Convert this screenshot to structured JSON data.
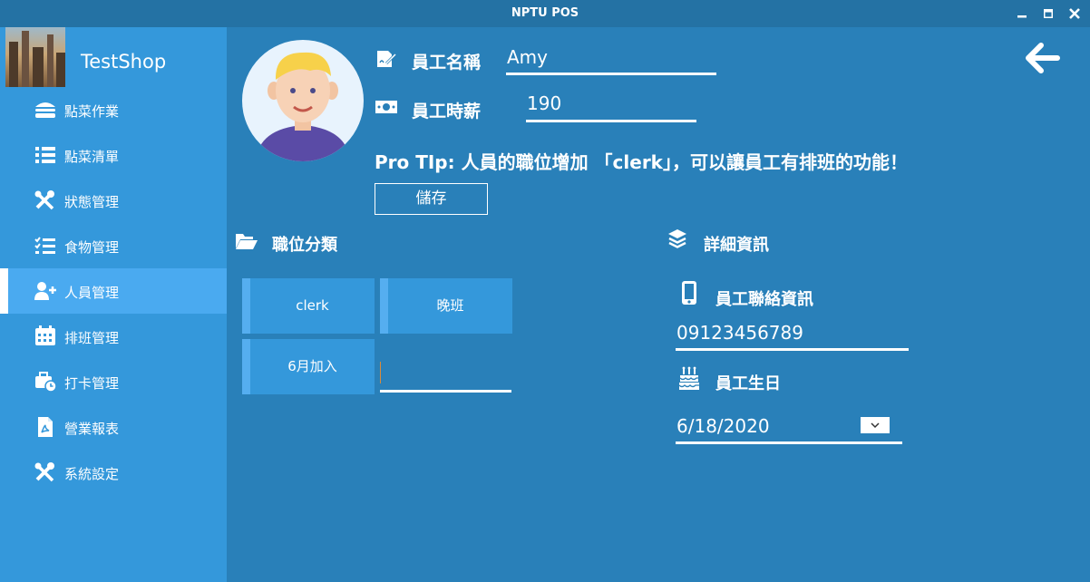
{
  "window": {
    "title": "NPTU POS"
  },
  "shop": {
    "name": "TestShop"
  },
  "sidebar": {
    "items": [
      {
        "label": "點菜作業",
        "icon": "burger-icon"
      },
      {
        "label": "點菜清單",
        "icon": "list-icon"
      },
      {
        "label": "狀態管理",
        "icon": "tools-icon"
      },
      {
        "label": "食物管理",
        "icon": "checklist-icon"
      },
      {
        "label": "人員管理",
        "icon": "user-plus-icon",
        "active": true
      },
      {
        "label": "排班管理",
        "icon": "calendar-icon"
      },
      {
        "label": "打卡管理",
        "icon": "briefcase-clock-icon"
      },
      {
        "label": "營業報表",
        "icon": "pdf-icon"
      },
      {
        "label": "系統設定",
        "icon": "tools-icon"
      }
    ]
  },
  "employee": {
    "name_label": "員工名稱",
    "name_value": "Amy",
    "wage_label": "員工時薪",
    "wage_value": "190",
    "tip": "Pro TIp: 人員的職位增加 「clerk」，可以讓員工有排班的功能！",
    "save_label": "儲存"
  },
  "positions": {
    "header": "職位分類",
    "chips": [
      "clerk",
      "晚班",
      "6月加入"
    ],
    "new_value": ""
  },
  "details": {
    "header": "詳細資訊",
    "contact_label": "員工聯絡資訊",
    "contact_value": "09123456789",
    "birthday_label": "員工生日",
    "birthday_value": "6/18/2020"
  },
  "colors": {
    "main_bg": "#2980b9",
    "sidebar_bg": "#3498db",
    "active_bg": "#4aaaf0",
    "titlebar_bg": "#2472a4"
  }
}
